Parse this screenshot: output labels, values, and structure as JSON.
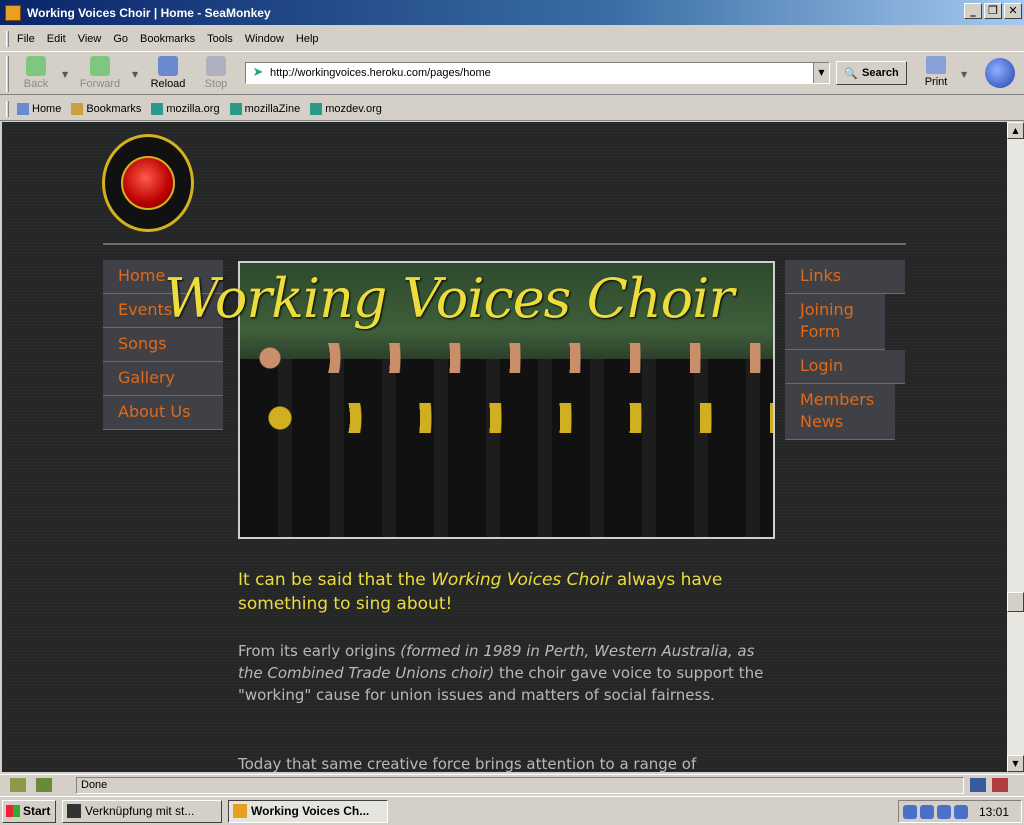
{
  "window": {
    "title": "Working Voices Choir | Home - SeaMonkey",
    "buttons": {
      "minimize": "_",
      "maximize": "❐",
      "close": "✕"
    }
  },
  "menubar": [
    "File",
    "Edit",
    "View",
    "Go",
    "Bookmarks",
    "Tools",
    "Window",
    "Help"
  ],
  "navbar": {
    "back": "Back",
    "forward": "Forward",
    "reload": "Reload",
    "stop": "Stop",
    "url": "http://workingvoices.heroku.com/pages/home",
    "search": "Search",
    "print": "Print"
  },
  "personal_toolbar": [
    "Home",
    "Bookmarks",
    "mozilla.org",
    "mozillaZine",
    "mozdev.org"
  ],
  "page": {
    "hero_title": "Working Voices Choir",
    "nav_left": [
      "Home",
      "Events",
      "Songs",
      "Gallery",
      "About Us"
    ],
    "nav_right": [
      "Links",
      "Joining Form",
      "Login",
      "Members News"
    ],
    "lede_prefix": "It can be said that the ",
    "lede_em": "Working Voices Choir",
    "lede_suffix": " always have something to sing about!",
    "para1_prefix": "From its early origins ",
    "para1_em": "(formed in 1989 in Perth, Western Australia, as the Combined Trade Unions choir)",
    "para1_suffix": " the choir gave voice to support the \"working\" cause for union issues and matters of social fairness.",
    "para2": "Today that same creative force brings attention to a range of"
  },
  "statusbar": {
    "text": "Done"
  },
  "taskbar": {
    "start": "Start",
    "items": [
      "Verknüpfung mit st...",
      "Working Voices Ch..."
    ],
    "clock": "13:01"
  },
  "colors": {
    "page_bg": "#252727",
    "nav_item_bg": "#3f4146",
    "nav_link": "#e06a18",
    "headline": "#ecdc3c",
    "body_text": "#b8b8b8"
  }
}
